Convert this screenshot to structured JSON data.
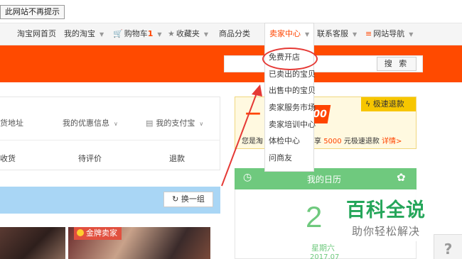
{
  "dismiss_label": "此网站不再提示",
  "nav": {
    "home": "淘宝网首页",
    "my_taobao": "我的淘宝",
    "cart_label": "购物车",
    "cart_count": "1",
    "favorites": "收藏夹",
    "categories": "商品分类",
    "seller_center": "卖家中心",
    "contact": "联系客服",
    "site_nav": "网站导航"
  },
  "search": {
    "button": "搜 索"
  },
  "seller_menu": [
    "免费开店",
    "已卖出的宝贝",
    "出售中的宝贝",
    "卖家服务市场",
    "卖家培训中心",
    "体检中心",
    "问商友"
  ],
  "left_panel": {
    "links": [
      "货地址",
      "我的优惠信息",
      "我的支付宝"
    ],
    "stats": [
      "收货",
      "待评价",
      "退款"
    ],
    "swap_button": "换一组",
    "badge": "金牌卖家"
  },
  "promo": {
    "tag": "极速退款",
    "big_number": "00",
    "line_prefix": "您是淘",
    "line_mid": "享",
    "amount": "5000",
    "line_suffix": "元极速退款",
    "detail_link": "详情>"
  },
  "calendar": {
    "title": "我的日历",
    "day": "2",
    "weekday": "星期六",
    "date": "2017.07"
  },
  "watermark": {
    "title": "百科全说",
    "subtitle": "助你轻松解决"
  },
  "help_label": "?",
  "colors": {
    "brand_orange": "#ff4a00",
    "annotation_red": "#e53935",
    "calendar_green": "#6fc97e",
    "watermark_green": "#25a65a"
  }
}
